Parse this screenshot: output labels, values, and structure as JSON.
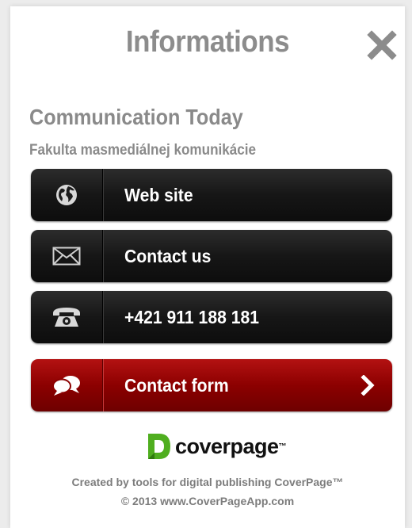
{
  "header": {
    "title": "Informations",
    "close_icon": "close-icon"
  },
  "organization": {
    "name": "Communication Today",
    "subtitle": "Fakulta masmediálnej komunikácie"
  },
  "actions": [
    {
      "label": "Web site",
      "icon": "globe-icon"
    },
    {
      "label": "Contact us",
      "icon": "envelope-icon"
    },
    {
      "label": "+421 911 188 181",
      "icon": "phone-icon"
    },
    {
      "label": "Contact form",
      "icon": "chat-bubbles-icon",
      "accent": "#9b0000"
    }
  ],
  "brand": {
    "name": "coverpage",
    "tm": "™",
    "logo_color": "#4fae1f"
  },
  "footer": {
    "line1": "Created by tools for digital publishing CoverPage™",
    "line2": "© 2013 www.CoverPageApp.com"
  }
}
